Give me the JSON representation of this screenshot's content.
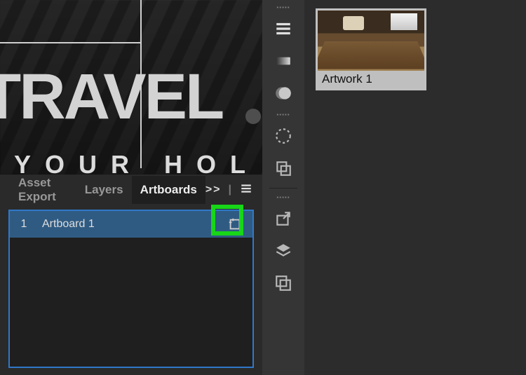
{
  "canvas": {
    "headline": "TRAVEL",
    "subline": "YOUR HOLIDA"
  },
  "tabs": {
    "items": [
      "Asset Export",
      "Layers",
      "Artboards"
    ],
    "activeIndex": 2,
    "overflowGlyph": ">>"
  },
  "artboards": {
    "rows": [
      {
        "index": "1",
        "name": "Artboard 1"
      }
    ]
  },
  "thumbnail": {
    "label": "Artwork 1"
  },
  "strip": {
    "groupLabel": "▪▪▪▪▪"
  },
  "colors": {
    "highlight": "#18d618",
    "selectionBorder": "#2f78c9",
    "rowSelected": "#2f5b83"
  }
}
